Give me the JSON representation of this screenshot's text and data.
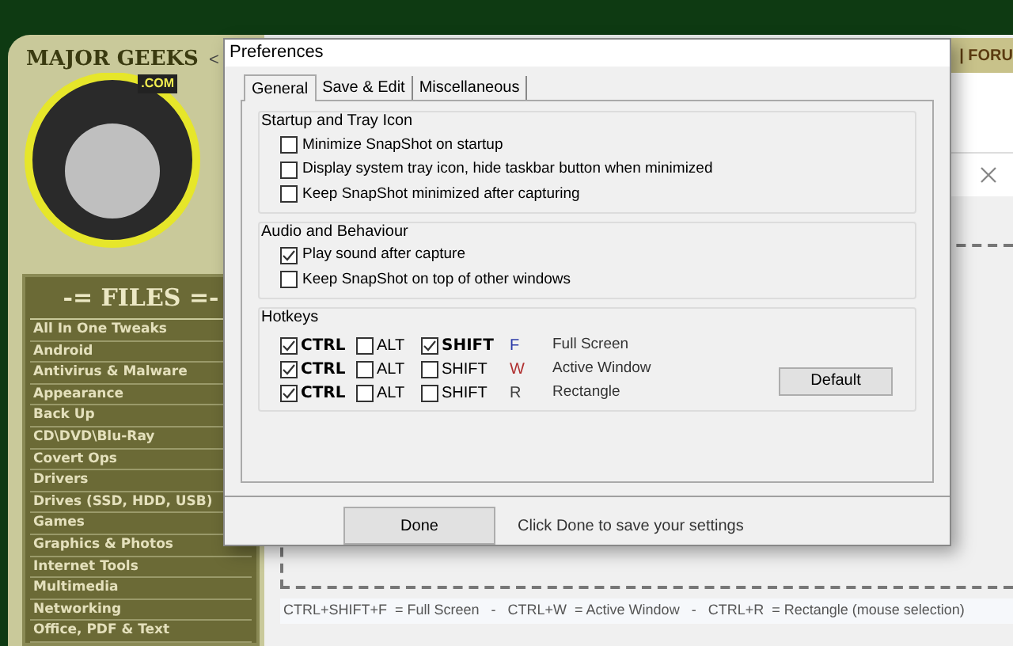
{
  "website": {
    "back_arrow": "<",
    "logo": {
      "title": "MAJOR GEEKS",
      "suffix": ".COM"
    },
    "nav_link": "| FORU",
    "files_heading": "-= FILES =-",
    "categories": [
      "All In One Tweaks",
      "Android",
      "Antivirus & Malware",
      "Appearance",
      "Back Up",
      "CD\\DVD\\Blu-Ray",
      "Covert Ops",
      "Drivers",
      "Drives (SSD, HDD, USB)",
      "Games",
      "Graphics & Photos",
      "Internet Tools",
      "Multimedia",
      "Networking",
      "Office, PDF & Text"
    ]
  },
  "background_app": {
    "status_hint": "CTRL+SHIFT+F  = Full Screen   -   CTRL+W  = Active Window   -   CTRL+R  = Rectangle (mouse selection)"
  },
  "dialog": {
    "title": "Preferences",
    "tabs": [
      {
        "label": "General",
        "selected": true
      },
      {
        "label": "Save & Edit",
        "selected": false
      },
      {
        "label": "Miscellaneous",
        "selected": false
      }
    ],
    "groups": [
      {
        "title": "Startup and Tray Icon",
        "options": [
          {
            "label": "Minimize SnapShot on startup",
            "checked": false
          },
          {
            "label": "Display system tray icon, hide taskbar button when minimized",
            "checked": false
          },
          {
            "label": "Keep SnapShot minimized after capturing",
            "checked": false
          }
        ]
      },
      {
        "title": "Audio and Behaviour",
        "options": [
          {
            "label": "Play sound after capture",
            "checked": true
          },
          {
            "label": "Keep SnapShot on top of other windows",
            "checked": false
          }
        ]
      }
    ],
    "hotkeys": {
      "title": "Hotkeys",
      "rows": [
        {
          "modifiers": [
            {
              "label": "CTRL",
              "checked": true
            },
            {
              "label": "ALT",
              "checked": false
            },
            {
              "label": "SHIFT",
              "checked": true
            }
          ],
          "key": "F",
          "color": "#2b3aa8",
          "action": "Full Screen"
        },
        {
          "modifiers": [
            {
              "label": "CTRL",
              "checked": true
            },
            {
              "label": "ALT",
              "checked": false
            },
            {
              "label": "SHIFT",
              "checked": false
            }
          ],
          "key": "W",
          "color": "#b03030",
          "action": "Active Window"
        },
        {
          "modifiers": [
            {
              "label": "CTRL",
              "checked": true
            },
            {
              "label": "ALT",
              "checked": false
            },
            {
              "label": "SHIFT",
              "checked": false
            }
          ],
          "key": "R",
          "color": "#404040",
          "action": "Rectangle"
        }
      ],
      "default_button": "Default"
    },
    "done_button": "Done",
    "done_hint": "Click Done to save your settings"
  }
}
